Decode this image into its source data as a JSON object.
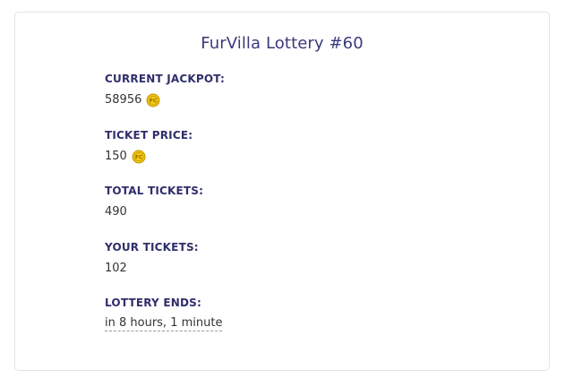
{
  "lottery": {
    "title": "FurVilla Lottery #60",
    "current_jackpot_label": "CURRENT JACKPOT:",
    "current_jackpot_value": "58956",
    "ticket_price_label": "TICKET PRICE:",
    "ticket_price_value": "150",
    "total_tickets_label": "TOTAL TICKETS:",
    "total_tickets_value": "490",
    "your_tickets_label": "YOUR TICKETS:",
    "your_tickets_value": "102",
    "lottery_ends_label": "LOTTERY ENDS:",
    "lottery_ends_value": "in 8 hours, 1 minute"
  },
  "icons": {
    "currency": "fc-coin-icon"
  },
  "colors": {
    "label": "#2f2f6b",
    "title": "#3a3a7c",
    "coin": "#f2c200"
  }
}
